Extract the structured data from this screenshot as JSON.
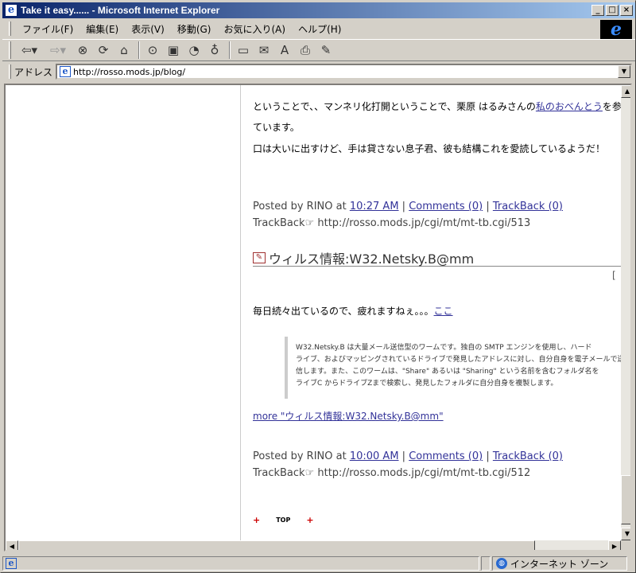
{
  "window": {
    "title": "Take it easy...... - Microsoft Internet Explorer",
    "min_label": "_",
    "max_label": "□",
    "close_label": "×"
  },
  "menu": {
    "items": [
      "ファイル(F)",
      "編集(E)",
      "表示(V)",
      "移動(G)",
      "お気に入り(A)",
      "ヘルプ(H)"
    ]
  },
  "address": {
    "label": "アドレス",
    "url": "http://rosso.mods.jp/blog/"
  },
  "toolbar_icons": [
    "back-arrow-icon",
    "forward-arrow-icon",
    "stop-icon",
    "refresh-icon",
    "home-icon",
    "search-icon",
    "favorites-icon",
    "history-icon",
    "channels-icon",
    "fullscreen-icon",
    "mail-icon",
    "font-icon",
    "print-icon",
    "edit-icon"
  ],
  "post1": {
    "line1_pre": "ということで、、マンネリ化打開ということで、栗原 はるみさんの",
    "line1_link": "私のおべんとう",
    "line1_post": "を参考",
    "line2": "ています。",
    "line3": "口は大いに出すけど、手は貸さない息子君、彼も結構これを愛読しているようだ！",
    "posted_pre": "Posted by RINO at",
    "time_link": "10:27 AM",
    "comments_link": "Comments (0)",
    "trackback_link": "TrackBack (0)",
    "trackback_label": "TrackBack",
    "trackback_url": "http://rosso.mods.jp/cgi/mt/mt-tb.cgi/513"
  },
  "post2": {
    "title": "ウィルス情報:W32.Netsky.B@mm",
    "bracket": "[",
    "intro": "毎日続々出ているので、疲れますねぇ。。。",
    "intro_link": "ここ",
    "quote_lines": [
      "W32.Netsky.B は大量メール送信型のワームです。独自の SMTP エンジンを使用し、ハード",
      "ライブ、およびマッピングされているドライブで発見したアドレスに対し、自分自身を電子メールで送",
      "信します。また、このワームは、\"Share\" あるいは \"Sharing\" という名前を含むフォルダ名を",
      "ライブC からドライブZまで検索し、発見したフォルダに自分自身を複製します。"
    ],
    "more_link": "more \"ウィルス情報:W32.Netsky.B@mm\"",
    "posted_pre": "Posted by RINO at",
    "time_link": "10:00 AM",
    "comments_link": "Comments (0)",
    "trackback_link": "TrackBack (0)",
    "trackback_label": "TrackBack",
    "trackback_url": "http://rosso.mods.jp/cgi/mt/mt-tb.cgi/512"
  },
  "footer": {
    "plus": "+",
    "top_label": "TOP"
  },
  "status": {
    "zone_label": "インターネット ゾーン"
  }
}
